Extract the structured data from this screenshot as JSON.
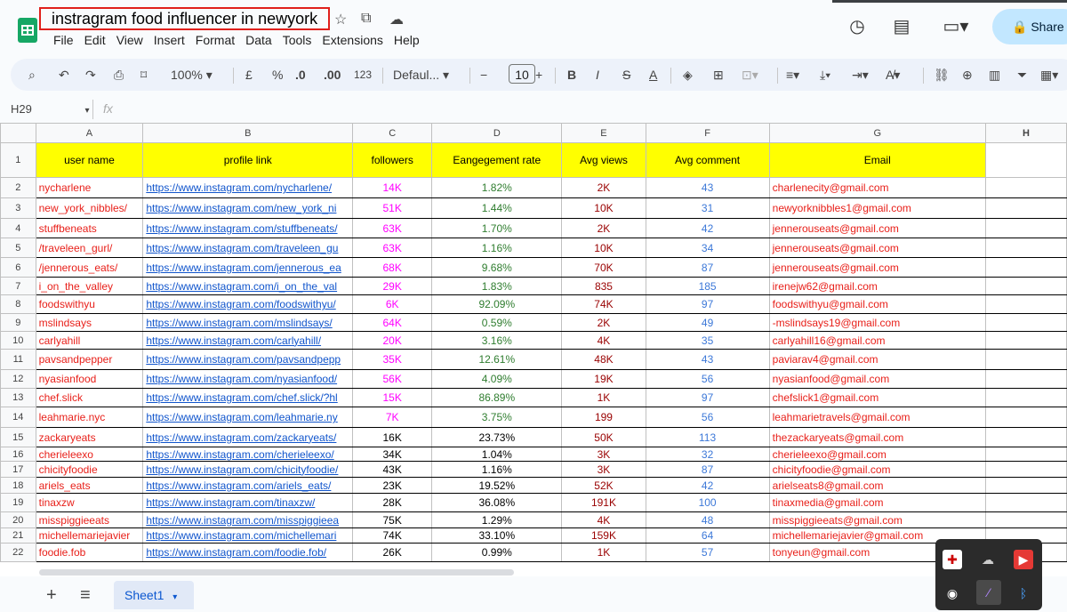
{
  "doc": {
    "title": "instragram food influencer in newyork"
  },
  "menu": [
    "File",
    "Edit",
    "View",
    "Insert",
    "Format",
    "Data",
    "Tools",
    "Extensions",
    "Help"
  ],
  "share_label": "Share",
  "toolbar": {
    "zoom": "100%",
    "currency": "£",
    "percent": "%",
    "dec_less": ".0",
    "dec_more": ".00",
    "number_format": "123",
    "font": "Defaul...",
    "font_size": "10"
  },
  "formula_bar": {
    "cell_ref": "H29",
    "fx": "fx"
  },
  "columns": [
    "A",
    "B",
    "C",
    "D",
    "E",
    "F",
    "G",
    "H"
  ],
  "header_row": {
    "num": "1",
    "cells": [
      "user name",
      "profile link",
      "followers",
      "Eangegement rate",
      "Avg views",
      "Avg comment",
      "Email"
    ]
  },
  "rows": [
    {
      "num": "2",
      "user": "nycharlene",
      "link": "https://www.instagram.com/nycharlene/",
      "followers": "14K",
      "rate": "1.82%",
      "views": "2K",
      "comments": "43",
      "email": "charlenecity@gmail.com"
    },
    {
      "num": "3",
      "user": "new_york_nibbles/",
      "link": "https://www.instagram.com/new_york_ni",
      "followers": "51K",
      "rate": "1.44%",
      "views": "10K",
      "comments": "31",
      "email": "newyorknibbles1@gmail.com"
    },
    {
      "num": "4",
      "user": "stuffbeneats",
      "link": "https://www.instagram.com/stuffbeneats/",
      "followers": "63K",
      "rate": "1.70%",
      "views": "2K",
      "comments": "42",
      "email": "jennerouseats@gmail.com"
    },
    {
      "num": "5",
      "user": "/traveleen_gurl/",
      "link": "https://www.instagram.com/traveleen_gu",
      "followers": "63K",
      "rate": "1.16%",
      "views": "10K",
      "comments": "34",
      "email": "jennerouseats@gmail.com"
    },
    {
      "num": "6",
      "user": "/jennerous_eats/",
      "link": "https://www.instagram.com/jennerous_ea",
      "followers": "68K",
      "rate": "9.68%",
      "views": "70K",
      "comments": "87",
      "email": "jennerouseats@gmail.com"
    },
    {
      "num": "7",
      "user": "i_on_the_valley",
      "link": "https://www.instagram.com/i_on_the_val",
      "followers": "29K",
      "rate": "1.83%",
      "views": "835",
      "comments": "185",
      "email": "irenejw62@gmail.com"
    },
    {
      "num": "8",
      "user": "foodswithyu",
      "link": "https://www.instagram.com/foodswithyu/",
      "followers": "6K",
      "rate": "92.09%",
      "views": "74K",
      "comments": "97",
      "email": "foodswithyu@gmail.com"
    },
    {
      "num": "9",
      "user": "mslindsays",
      "link": "https://www.instagram.com/mslindsays/",
      "followers": "64K",
      "rate": "0.59%",
      "views": "2K",
      "comments": "49",
      "email": "-mslindsays19@gmail.com"
    },
    {
      "num": "10",
      "user": "carlyahill",
      "link": "https://www.instagram.com/carlyahill/",
      "followers": "20K",
      "rate": "3.16%",
      "views": "4K",
      "comments": "35",
      "email": "carlyahill16@gmail.com"
    },
    {
      "num": "11",
      "user": "pavsandpepper",
      "link": "https://www.instagram.com/pavsandpepp",
      "followers": "35K",
      "rate": "12.61%",
      "views": "48K",
      "comments": "43",
      "email": "paviarav4@gmail.com"
    },
    {
      "num": "12",
      "user": "nyasianfood",
      "link": "https://www.instagram.com/nyasianfood/",
      "followers": "56K",
      "rate": "4.09%",
      "views": "19K",
      "comments": "56",
      "email": "nyasianfood@gmail.com"
    },
    {
      "num": "13",
      "user": "chef.slick",
      "link": "https://www.instagram.com/chef.slick/?hl",
      "followers": "15K",
      "rate": "86.89%",
      "views": "1K",
      "comments": "97",
      "email": "chefslick1@gmail.com"
    },
    {
      "num": "14",
      "user": "leahmarie.nyc",
      "link": "https://www.instagram.com/leahmarie.ny",
      "followers": "7K",
      "rate": "3.75%",
      "views": "199",
      "comments": "56",
      "email": "leahmarietravels@gmail.com"
    },
    {
      "num": "15",
      "user": "zackaryeats",
      "link": "https://www.instagram.com/zackaryeats/",
      "followers": "16K",
      "rate": "23.73%",
      "views": "50K",
      "comments": "113",
      "email": "thezackaryeats@gmail.com"
    },
    {
      "num": "16",
      "user": "cherieleexo",
      "link": "https://www.instagram.com/cherieleexo/",
      "followers": "34K",
      "rate": "1.04%",
      "views": "3K",
      "comments": "32",
      "email": "cherieleexo@gmail.com"
    },
    {
      "num": "17",
      "user": "chicityfoodie",
      "link": "https://www.instagram.com/chicityfoodie/",
      "followers": "43K",
      "rate": "1.16%",
      "views": "3K",
      "comments": "87",
      "email": "chicityfoodie@gmail.com"
    },
    {
      "num": "18",
      "user": "ariels_eats",
      "link": "https://www.instagram.com/ariels_eats/",
      "followers": "23K",
      "rate": "19.52%",
      "views": "52K",
      "comments": "42",
      "email": "arielseats8@gmail.com"
    },
    {
      "num": "19",
      "user": "tinaxzw",
      "link": "https://www.instagram.com/tinaxzw/",
      "followers": "28K",
      "rate": "36.08%",
      "views": "191K",
      "comments": "100",
      "email": "tinaxmedia@gmail.com"
    },
    {
      "num": "20",
      "user": "misspiggieeats",
      "link": "https://www.instagram.com/misspiggieea",
      "followers": "75K",
      "rate": "1.29%",
      "views": "4K",
      "comments": "48",
      "email": "misspiggieeats@gmail.com"
    },
    {
      "num": "21",
      "user": "michellemariejavier",
      "link": "https://www.instagram.com/michellemari",
      "followers": "74K",
      "rate": "33.10%",
      "views": "159K",
      "comments": "64",
      "email": "michellemariejavier@gmail.com"
    },
    {
      "num": "22",
      "user": "foodie.fob",
      "link": "https://www.instagram.com/foodie.fob/",
      "followers": "26K",
      "rate": "0.99%",
      "views": "1K",
      "comments": "57",
      "email": "tonyeun@gmail.com"
    }
  ],
  "sheet_tab": "Sheet1",
  "add_sheet": "+",
  "all_sheets": "≡"
}
